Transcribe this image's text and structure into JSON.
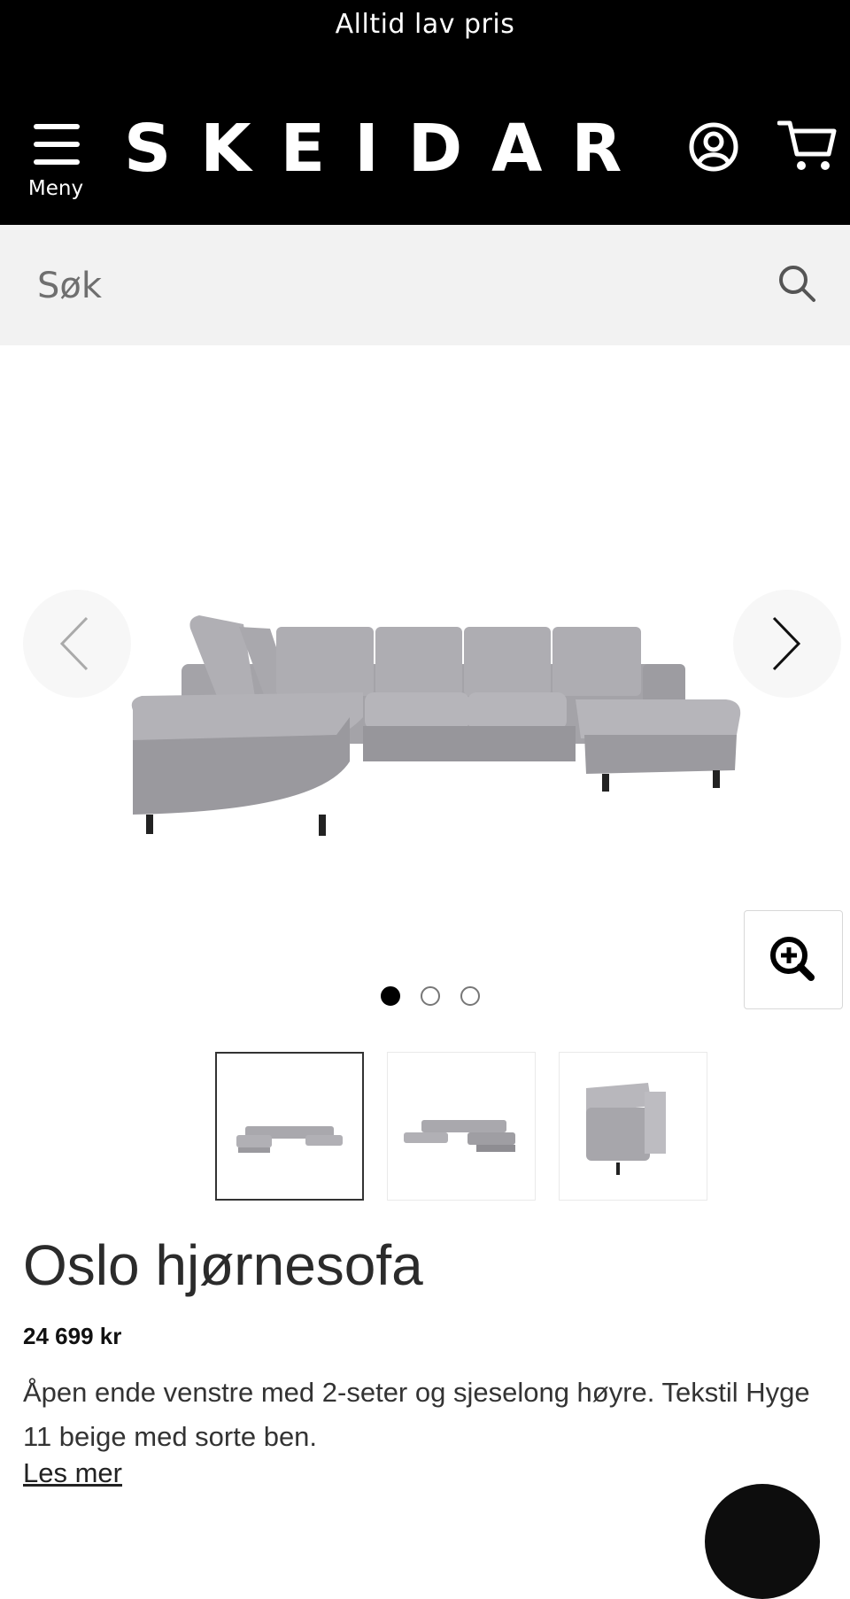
{
  "header": {
    "promo_text": "Alltid lav pris",
    "menu_label": "Meny",
    "logo_text": "SKEIDAR",
    "icons": {
      "menu": "hamburger-icon",
      "account": "user-circle-icon",
      "cart": "shopping-cart-icon"
    }
  },
  "search": {
    "placeholder": "Søk",
    "icon": "search-icon"
  },
  "gallery": {
    "total_images": 3,
    "active_index": 0,
    "zoom_icon": "zoom-in-icon",
    "prev_icon": "chevron-left-icon",
    "next_icon": "chevron-right-icon"
  },
  "product": {
    "name": "Oslo hjørnesofa",
    "price": "24 699 kr",
    "description": "Åpen ende venstre med 2-seter og sjeselong høyre. Tekstil Hyge 11 beige med sorte ben.",
    "read_more": "Les mer"
  },
  "colors": {
    "header_bg": "#000000",
    "search_bg": "#f2f2f2",
    "sofa": "#a9a8ad"
  }
}
